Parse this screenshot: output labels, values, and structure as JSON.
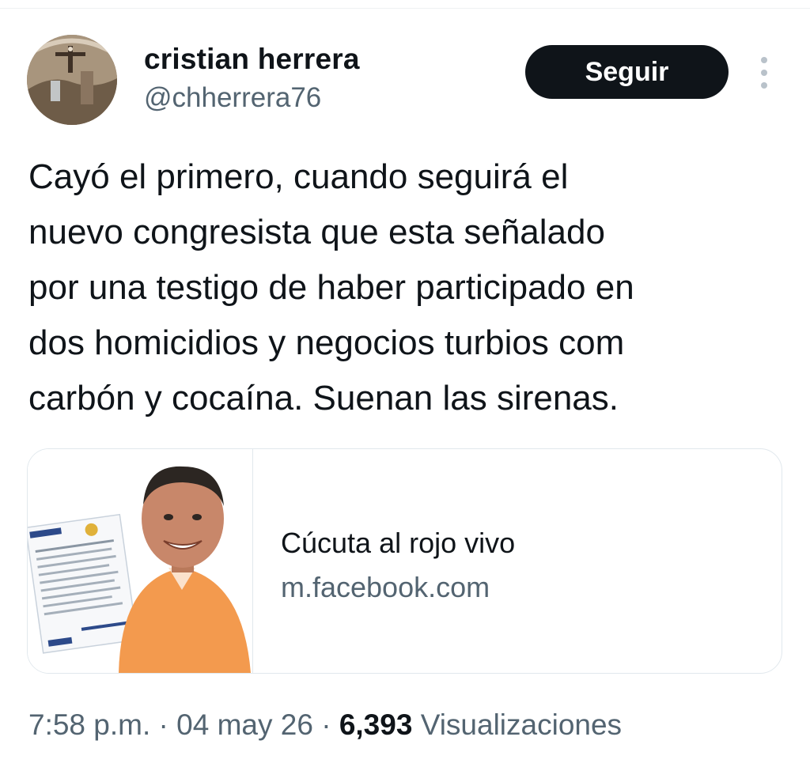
{
  "author": {
    "display_name": "cristian herrera",
    "handle": "@chherrera76",
    "avatar_icon": "avatar-crucifix-photo"
  },
  "follow_button": {
    "label": "Seguir"
  },
  "more_options": {
    "icon": "more-vertical-icon"
  },
  "tweet": {
    "text": "Cayó el primero, cuando seguirá el\nnuevo congresista que esta señalado\npor una testigo de haber participado en\ndos homicidios y negocios turbios com\ncarbón y cocaína. Suenan las sirenas."
  },
  "link_card": {
    "title": "Cúcuta al rojo vivo",
    "domain": "m.facebook.com"
  },
  "meta": {
    "time": "7:58 p.m.",
    "separator": "·",
    "date": "04 may 26",
    "views_count": "6,393",
    "views_label": "Visualizaciones"
  },
  "colors": {
    "text_primary": "#0f1419",
    "text_secondary": "#536471",
    "button_bg": "#0f1419",
    "card_border": "#e1e8ed",
    "shirt_orange": "#f39a4e"
  }
}
